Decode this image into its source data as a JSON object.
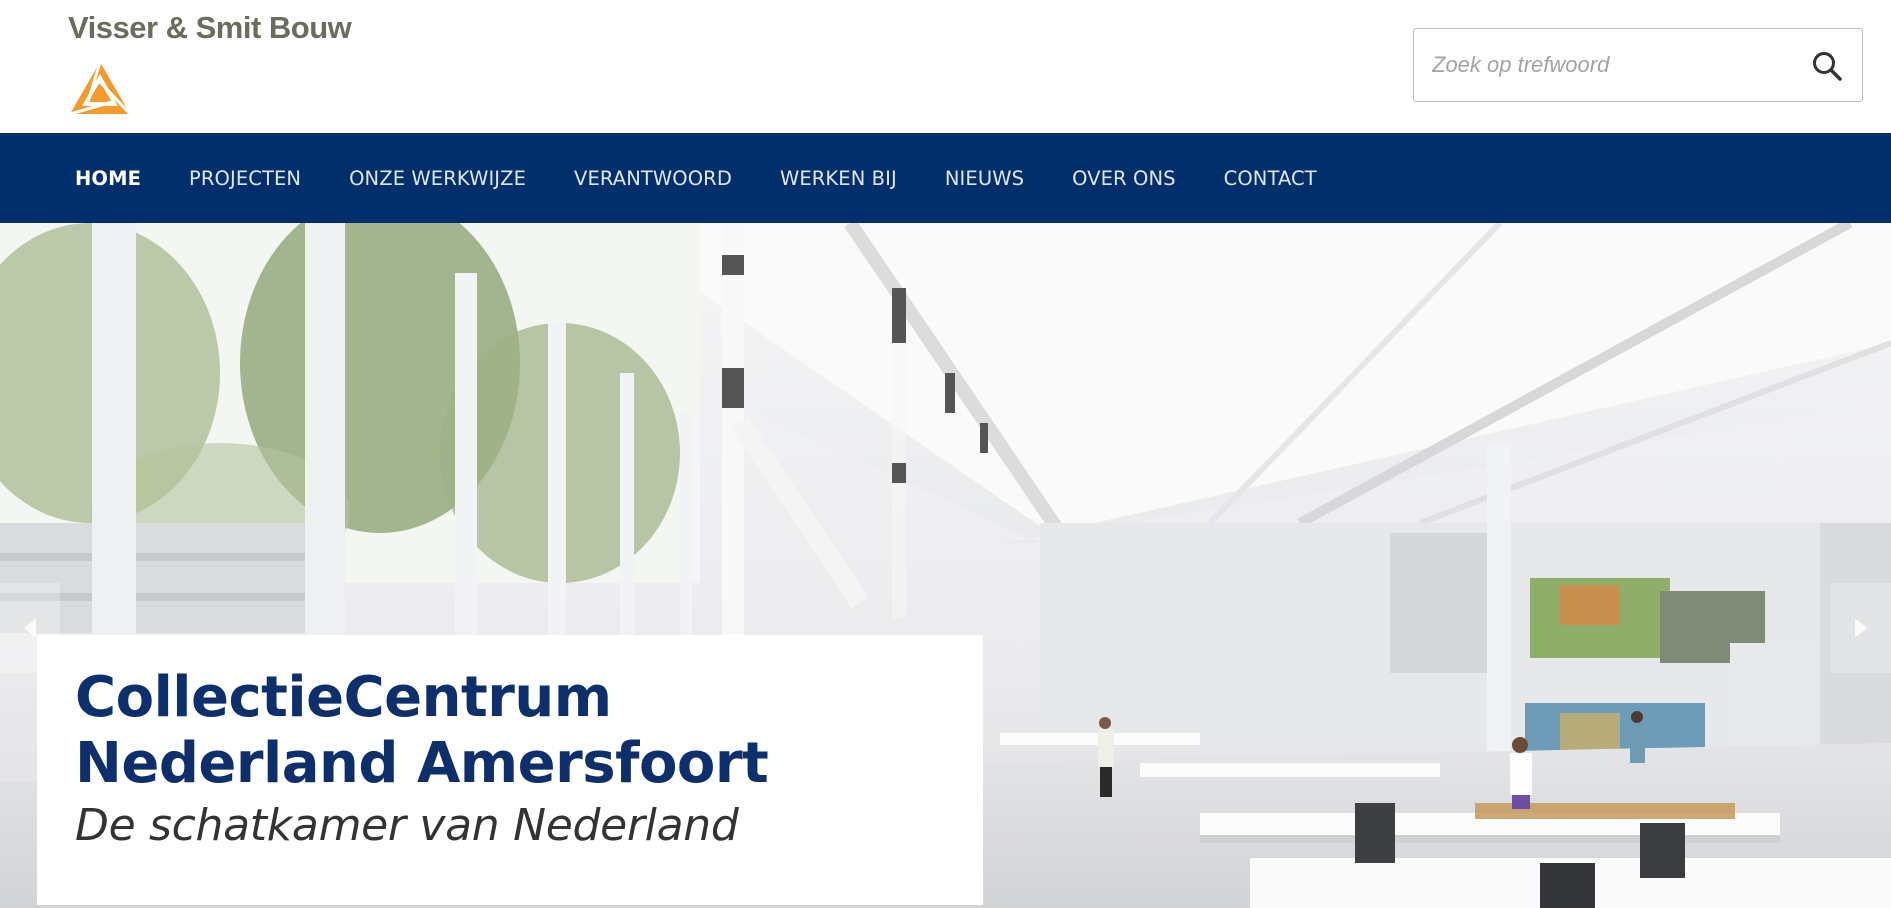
{
  "brand": {
    "name": "Visser & Smit Bouw",
    "accent_color": "#f39a2b",
    "text_color": "#6b6b5e"
  },
  "search": {
    "placeholder": "Zoek op trefwoord",
    "value": "",
    "icon": "search-icon"
  },
  "nav": {
    "background": "#002f6c",
    "items": [
      {
        "label": "HOME",
        "active": true
      },
      {
        "label": "PROJECTEN",
        "active": false
      },
      {
        "label": "ONZE WERKWIJZE",
        "active": false
      },
      {
        "label": "VERANTWOORD",
        "active": false
      },
      {
        "label": "WERKEN BIJ",
        "active": false
      },
      {
        "label": "NIEUWS",
        "active": false
      },
      {
        "label": "OVER ONS",
        "active": false
      },
      {
        "label": "CONTACT",
        "active": false
      }
    ]
  },
  "hero": {
    "title": "CollectieCentrum Nederland Amersfoort",
    "subtitle": "De schatkamer van Nederland",
    "prev_icon": "chevron-left-icon",
    "next_icon": "chevron-right-icon",
    "title_color": "#0d2f6b"
  }
}
